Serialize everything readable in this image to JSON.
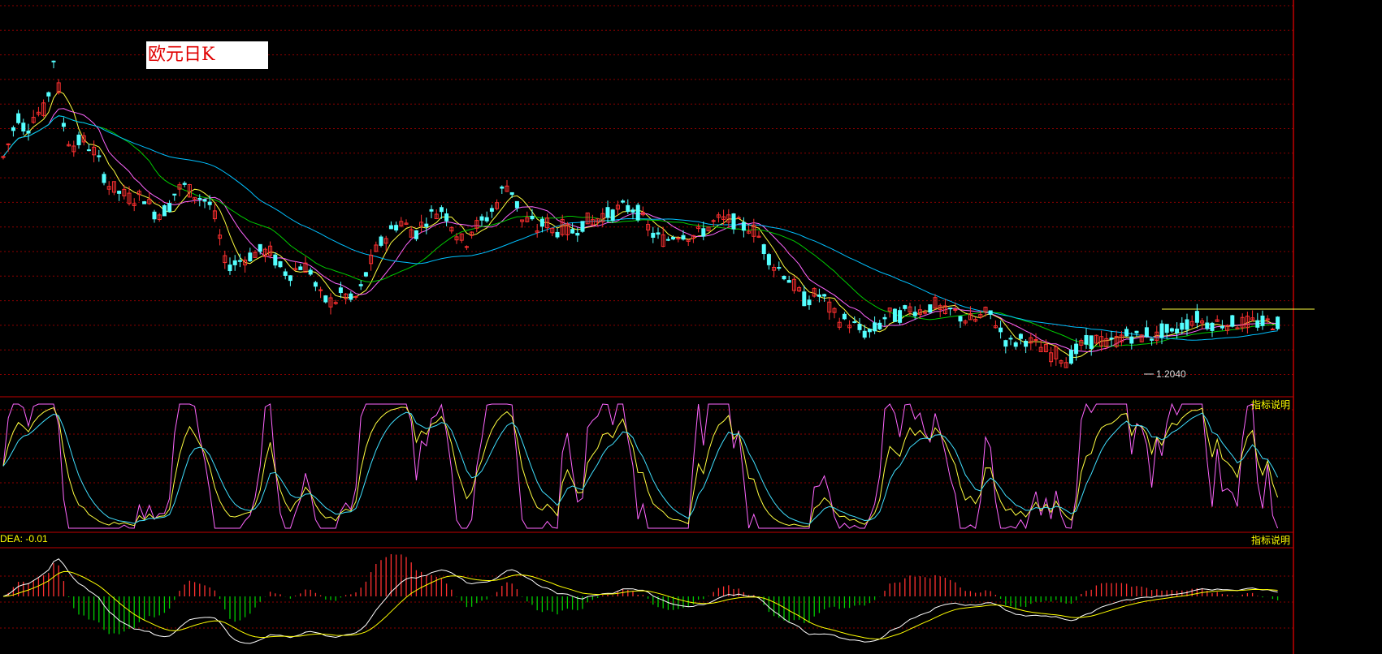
{
  "title": "欧元日K",
  "low_annotation": "1.2040",
  "indicator_label_1": "指标说明",
  "indicator_label_2": "指标说明",
  "dea_label": "DEA: -0.01",
  "colors": {
    "background": "#000000",
    "grid": "#8b0000",
    "border": "#c00000",
    "up_candle": "#ff3030",
    "down_candle": "#54ffff",
    "ma_fast": "#ffff40",
    "ma_mid": "#ff66ff",
    "ma_slow": "#00cc00",
    "ma_long": "#00c0ff",
    "kdj_k": "#ff66ff",
    "kdj_d": "#ffff40",
    "kdj_j": "#40e0ff",
    "macd_dif": "#ffffff",
    "macd_dea": "#ffff00",
    "hist_pos": "#ff3030",
    "hist_neg": "#00cc00"
  },
  "chart_data": {
    "type": "candlestick",
    "title": "欧元日K",
    "annotations": [
      {
        "label": "1.2040",
        "kind": "period-low"
      }
    ],
    "price_path": [
      [
        0,
        1.255
      ],
      [
        10,
        1.262
      ],
      [
        20,
        1.27
      ],
      [
        30,
        1.265
      ],
      [
        40,
        1.27
      ],
      [
        55,
        1.272
      ],
      [
        65,
        1.29
      ],
      [
        75,
        1.268
      ],
      [
        85,
        1.26
      ],
      [
        100,
        1.262
      ],
      [
        115,
        1.258
      ],
      [
        130,
        1.248
      ],
      [
        145,
        1.245
      ],
      [
        160,
        1.243
      ],
      [
        175,
        1.244
      ],
      [
        190,
        1.238
      ],
      [
        205,
        1.24
      ],
      [
        215,
        1.246
      ],
      [
        225,
        1.247
      ],
      [
        240,
        1.244
      ],
      [
        255,
        1.242
      ],
      [
        265,
        1.235
      ],
      [
        275,
        1.222
      ],
      [
        285,
        1.222
      ],
      [
        300,
        1.224
      ],
      [
        315,
        1.226
      ],
      [
        330,
        1.226
      ],
      [
        345,
        1.22
      ],
      [
        355,
        1.219
      ],
      [
        370,
        1.222
      ],
      [
        380,
        1.22
      ],
      [
        390,
        1.212
      ],
      [
        400,
        1.21
      ],
      [
        410,
        1.21
      ],
      [
        420,
        1.213
      ],
      [
        430,
        1.21
      ],
      [
        440,
        1.212
      ],
      [
        450,
        1.22
      ],
      [
        460,
        1.226
      ],
      [
        470,
        1.23
      ],
      [
        480,
        1.233
      ],
      [
        490,
        1.236
      ],
      [
        500,
        1.234
      ],
      [
        510,
        1.232
      ],
      [
        520,
        1.236
      ],
      [
        530,
        1.238
      ],
      [
        540,
        1.24
      ],
      [
        550,
        1.237
      ],
      [
        560,
        1.232
      ],
      [
        570,
        1.228
      ],
      [
        580,
        1.234
      ],
      [
        590,
        1.235
      ],
      [
        600,
        1.238
      ],
      [
        610,
        1.242
      ],
      [
        620,
        1.248
      ],
      [
        630,
        1.245
      ],
      [
        640,
        1.236
      ],
      [
        650,
        1.236
      ],
      [
        660,
        1.233
      ],
      [
        670,
        1.236
      ],
      [
        680,
        1.232
      ],
      [
        690,
        1.234
      ],
      [
        700,
        1.232
      ],
      [
        710,
        1.234
      ],
      [
        720,
        1.236
      ],
      [
        730,
        1.236
      ],
      [
        740,
        1.238
      ],
      [
        750,
        1.238
      ],
      [
        760,
        1.24
      ],
      [
        770,
        1.24
      ],
      [
        780,
        1.24
      ],
      [
        790,
        1.236
      ],
      [
        800,
        1.232
      ],
      [
        810,
        1.23
      ],
      [
        820,
        1.23
      ],
      [
        830,
        1.232
      ],
      [
        840,
        1.232
      ],
      [
        850,
        1.231
      ],
      [
        860,
        1.232
      ],
      [
        870,
        1.234
      ],
      [
        880,
        1.236
      ],
      [
        890,
        1.236
      ],
      [
        900,
        1.236
      ],
      [
        910,
        1.234
      ],
      [
        920,
        1.234
      ],
      [
        930,
        1.232
      ],
      [
        940,
        1.226
      ],
      [
        950,
        1.222
      ],
      [
        960,
        1.22
      ],
      [
        970,
        1.217
      ],
      [
        980,
        1.213
      ],
      [
        990,
        1.21
      ],
      [
        1000,
        1.212
      ],
      [
        1010,
        1.212
      ],
      [
        1020,
        1.207
      ],
      [
        1030,
        1.204
      ],
      [
        1040,
        1.204
      ],
      [
        1050,
        1.202
      ],
      [
        1060,
        1.2
      ],
      [
        1070,
        1.2
      ],
      [
        1080,
        1.202
      ],
      [
        1090,
        1.206
      ],
      [
        1100,
        1.205
      ],
      [
        1110,
        1.206
      ],
      [
        1120,
        1.208
      ],
      [
        1130,
        1.207
      ],
      [
        1140,
        1.208
      ],
      [
        1150,
        1.209
      ],
      [
        1160,
        1.206
      ],
      [
        1170,
        1.207
      ],
      [
        1180,
        1.205
      ],
      [
        1190,
        1.204
      ],
      [
        1200,
        1.204
      ],
      [
        1210,
        1.206
      ],
      [
        1220,
        1.205
      ],
      [
        1230,
        1.2
      ],
      [
        1240,
        1.196
      ],
      [
        1250,
        1.197
      ],
      [
        1260,
        1.198
      ],
      [
        1270,
        1.196
      ],
      [
        1280,
        1.195
      ],
      [
        1290,
        1.193
      ],
      [
        1300,
        1.193
      ],
      [
        1310,
        1.191
      ],
      [
        1320,
        1.193
      ],
      [
        1330,
        1.196
      ],
      [
        1340,
        1.197
      ],
      [
        1350,
        1.198
      ],
      [
        1360,
        1.196
      ],
      [
        1370,
        1.197
      ],
      [
        1380,
        1.199
      ],
      [
        1390,
        1.199
      ],
      [
        1400,
        1.198
      ],
      [
        1410,
        1.2
      ],
      [
        1420,
        1.198
      ],
      [
        1430,
        1.201
      ],
      [
        1440,
        1.199
      ],
      [
        1450,
        1.202
      ],
      [
        1460,
        1.203
      ],
      [
        1470,
        1.205
      ],
      [
        1480,
        1.203
      ]
    ],
    "price_range": [
      1.186,
      1.298
    ],
    "panels": [
      "candlestick + moving averages",
      "KDJ oscillator",
      "MACD (DIF/DEA + histogram)"
    ]
  }
}
